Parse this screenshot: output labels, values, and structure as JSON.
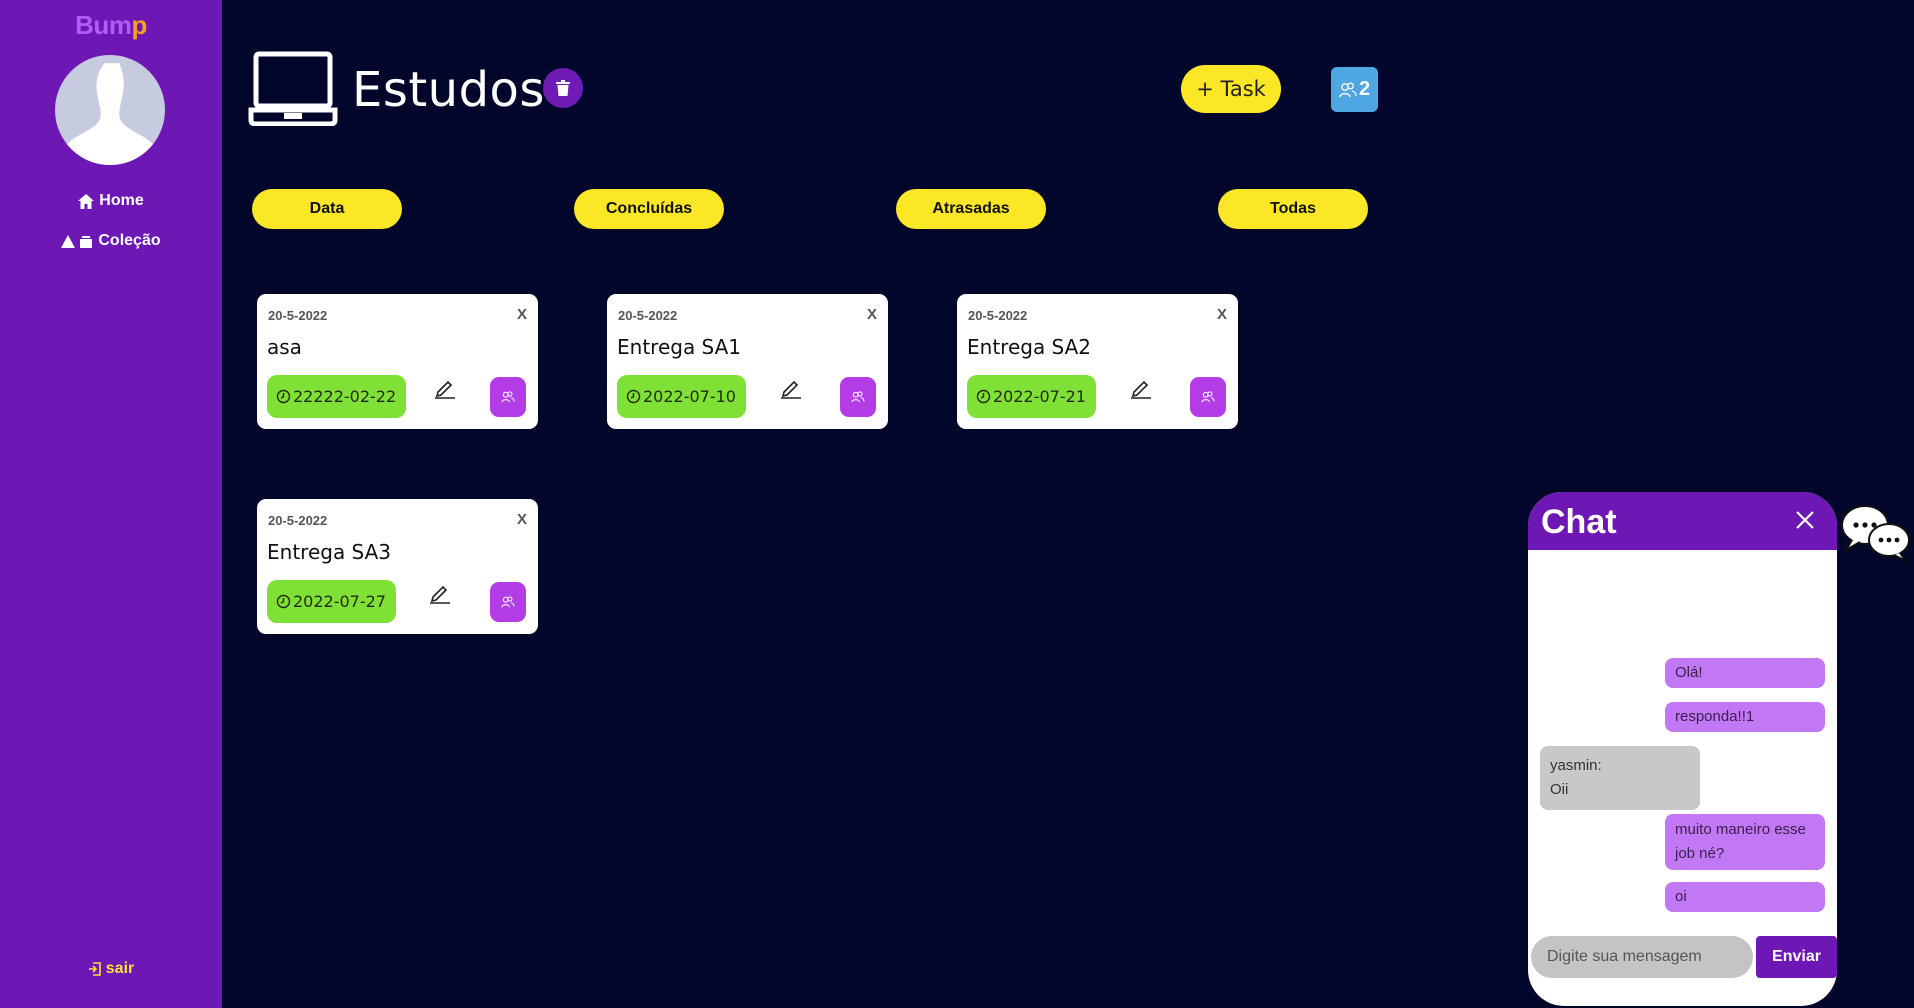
{
  "app": {
    "logo_part1": "Bum",
    "logo_part2": "p"
  },
  "sidebar": {
    "items": [
      {
        "label": "Home",
        "icon": "home-icon"
      },
      {
        "label": "Coleção",
        "icon": "shapes-icon"
      }
    ],
    "logout_label": "sair"
  },
  "header": {
    "title": "Estudos",
    "add_task_label": "+ Task",
    "members_count": "2"
  },
  "filters": [
    "Data",
    "Concluídas",
    "Atrasadas",
    "Todas"
  ],
  "cards": [
    {
      "date": "20-5-2022",
      "close": "X",
      "title": "asa",
      "due": "22222-02-22"
    },
    {
      "date": "20-5-2022",
      "close": "X",
      "title": "Entrega SA1",
      "due": "2022-07-10"
    },
    {
      "date": "20-5-2022",
      "close": "X",
      "title": "Entrega SA2",
      "due": "2022-07-21"
    },
    {
      "date": "20-5-2022",
      "close": "X",
      "title": "Entrega SA3",
      "due": "2022-07-27"
    }
  ],
  "chat": {
    "title": "Chat",
    "messages": [
      {
        "from": "me",
        "text": "Olá!"
      },
      {
        "from": "me",
        "text": "responda!!1"
      },
      {
        "from": "other",
        "sender": "yasmin:",
        "text": "Oii"
      },
      {
        "from": "me",
        "text": "muito maneiro esse job né?"
      },
      {
        "from": "me",
        "text": "oi"
      }
    ],
    "input_placeholder": "Digite sua mensagem",
    "send_label": "Enviar"
  },
  "colors": {
    "sidebar": "#6d17b4",
    "background": "#02062a",
    "accent_yellow": "#fbe726",
    "due_green": "#7fe035",
    "assign_purple": "#b43ce6",
    "members_blue": "#4ea7e3"
  }
}
